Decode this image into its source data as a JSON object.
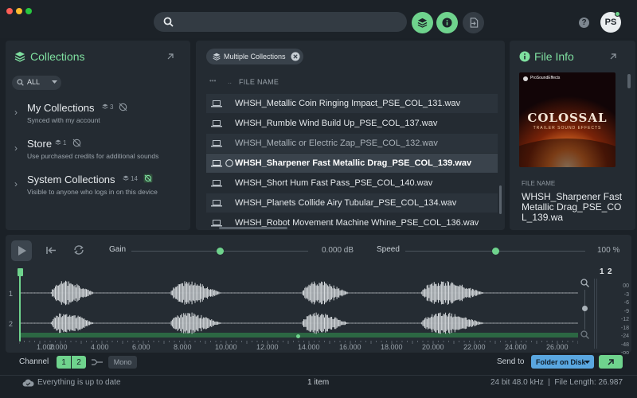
{
  "colors": {
    "accent": "#6fd38d",
    "background": "#1b2127",
    "panel": "#242b32",
    "waveform": "#d9dde0",
    "send_button": "#5aa7e0"
  },
  "topbar": {
    "window_controls": [
      "close",
      "minimize",
      "maximize"
    ],
    "search": {
      "placeholder": "",
      "icon": "search-icon"
    },
    "buttons": [
      "layers-icon",
      "info-icon",
      "export-icon"
    ],
    "help_label": "?",
    "avatar_initials": "PS"
  },
  "collections": {
    "title": "Collections",
    "filter_label": "ALL",
    "items": [
      {
        "name": "My Collections",
        "count": "3",
        "subtitle": "Synced with my account"
      },
      {
        "name": "Store",
        "count": "1",
        "subtitle": "Use purchased credits for additional sounds"
      },
      {
        "name": "System Collections",
        "count": "14",
        "subtitle": "Visible to anyone who logs in on this device"
      }
    ]
  },
  "files": {
    "chip_label": "Multiple Collections",
    "column_dots": "•••",
    "column_ellipsis": "..",
    "column_header": "FILE NAME",
    "rows": [
      "WHSH_Metallic Coin Ringing Impact_PSE_COL_131.wav",
      "WHSH_Rumble Wind Build Up_PSE_COL_137.wav",
      "WHSH_Metallic or Electric Zap_PSE_COL_132.wav",
      "WHSH_Sharpener Fast Metallic Drag_PSE_COL_139.wav",
      "WHSH_Short Hum Fast Pass_PSE_COL_140.wav",
      "WHSH_Planets Collide Airy Tubular_PSE_COL_134.wav",
      "WHSH_Robot Movement Machine Whine_PSE_COL_136.wav"
    ],
    "selected_index": 3
  },
  "file_info": {
    "title": "File Info",
    "cover_brand": "ProSoundEffects",
    "cover_title": "COLOSSAL",
    "cover_subtitle": "TRAILER SOUND EFFECTS",
    "field_label": "FILE NAME",
    "file_name": "WHSH_Sharpener Fast Metallic Drag_PSE_COL_139.wa"
  },
  "player": {
    "gain_label": "Gain",
    "gain_value": "0.000 dB",
    "gain_level": 0.5,
    "speed_label": "Speed",
    "speed_value": "100 %",
    "speed_level": 0.5,
    "channel_labels": [
      "1",
      "2"
    ],
    "meter_channels": [
      "1",
      "2"
    ],
    "meter_scale": [
      "00",
      "-3",
      "-6",
      "-9",
      "-12",
      "-18",
      "-24",
      "-48",
      "-oo"
    ],
    "timeline_ticks": [
      "1.000",
      "2.000",
      "4.000",
      "6.000",
      "8.000",
      "10.000",
      "12.000",
      "14.000",
      "16.000",
      "18.000",
      "20.000",
      "22.000",
      "24.000",
      "26.000"
    ]
  },
  "footer": {
    "channel_label": "Channel",
    "channel_buttons": [
      "1",
      "2"
    ],
    "mono_label": "Mono",
    "send_to_label": "Send to",
    "send_target": "Folder on Disk"
  },
  "status": {
    "sync_text": "Everything is up to date",
    "item_count": "1 item",
    "file_meta": "24 bit 48.0 kHz  |  File Length: 26.987"
  }
}
